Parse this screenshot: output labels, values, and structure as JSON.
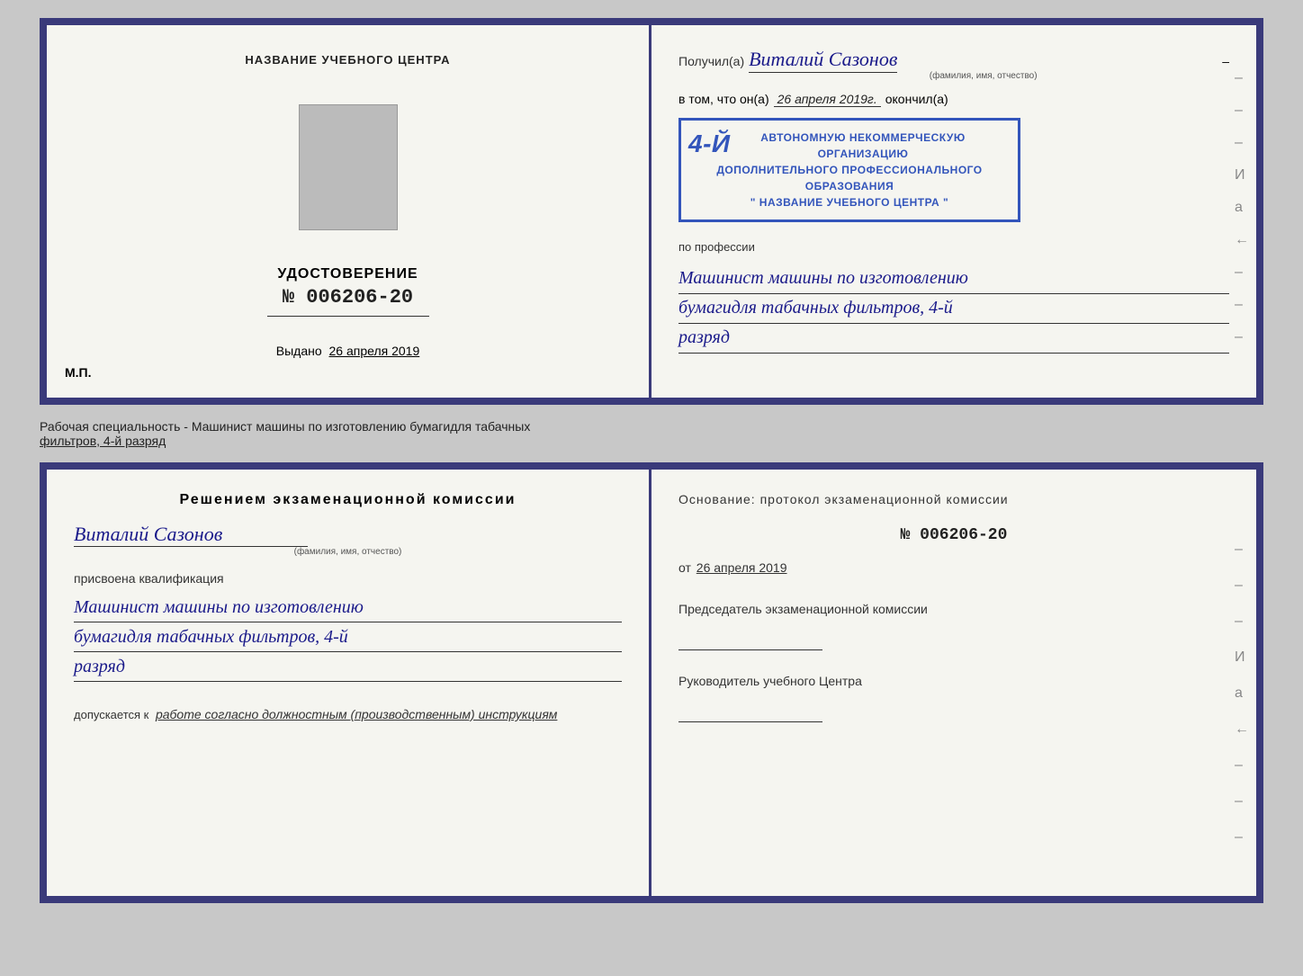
{
  "topDoc": {
    "leftPage": {
      "centerTitle": "НАЗВАНИЕ УЧЕБНОГО ЦЕНТРА",
      "photoAlt": "photo",
      "udostoverenie": "УДОСТОВЕРЕНИЕ",
      "number": "№ 006206-20",
      "issuedLabel": "Выдано",
      "issuedDate": "26 апреля 2019",
      "mp": "М.П."
    },
    "rightPage": {
      "poluchilLabel": "Получил(а)",
      "recipientName": "Виталий Сазонов",
      "fioHint": "(фамилия, имя, отчество)",
      "vtomChtoLabel": "в том, что он(а)",
      "vtomDate": "26 апреля 2019г.",
      "okonchilLabel": "окончил(а)",
      "stampLine1": "4-й",
      "stampLine2": "АВТОНОМНУЮ НЕКОММЕРЧЕСКУЮ ОРГАНИЗАЦИЮ",
      "stampLine3": "ДОПОЛНИТЕЛЬНОГО ПРОФЕССИОНАЛЬНОГО ОБРАЗОВАНИЯ",
      "stampLine4": "\" НАЗВАНИЕ УЧЕБНОГО ЦЕНТРА \"",
      "poProffesiiLabel": "по профессии",
      "professionLine1": "Машинист машины по изготовлению",
      "professionLine2": "бумагидля табачных фильтров, 4-й",
      "professionLine3": "разряд",
      "dashes": [
        "-",
        "-",
        "-",
        "И",
        "а",
        "←",
        "-",
        "-",
        "-"
      ]
    }
  },
  "infoStrip": {
    "text1": "Рабочая специальность - Машинист машины по изготовлению бумагидля табачных",
    "text2": "фильтров, 4-й разряд"
  },
  "bottomDoc": {
    "leftPage": {
      "resheniyeTitle": "Решением экзаменационной комиссии",
      "personName": "Виталий Сазонов",
      "fioHint": "(фамилия, имя, отчество)",
      "prisvoenaLabel": "присвоена квалификация",
      "qualificationLine1": "Машинист машины по изготовлению",
      "qualificationLine2": "бумагидля табачных фильтров, 4-й",
      "qualificationLine3": "разряд",
      "dopuskaetsyaLabel": "допускается к",
      "dopuskaetsyaValue": "работе согласно должностным (производственным) инструкциям"
    },
    "rightPage": {
      "osnovaniyeText": "Основание: протокол экзаменационной комиссии",
      "protocolNumber": "№ 006206-20",
      "otLabel": "от",
      "otDate": "26 апреля 2019",
      "predsedatelLabel": "Председатель экзаменационной комиссии",
      "rukovoditelLabel": "Руководитель учебного Центра",
      "dashes": [
        "-",
        "-",
        "-",
        "И",
        "а",
        "←",
        "-",
        "-",
        "-"
      ]
    }
  }
}
